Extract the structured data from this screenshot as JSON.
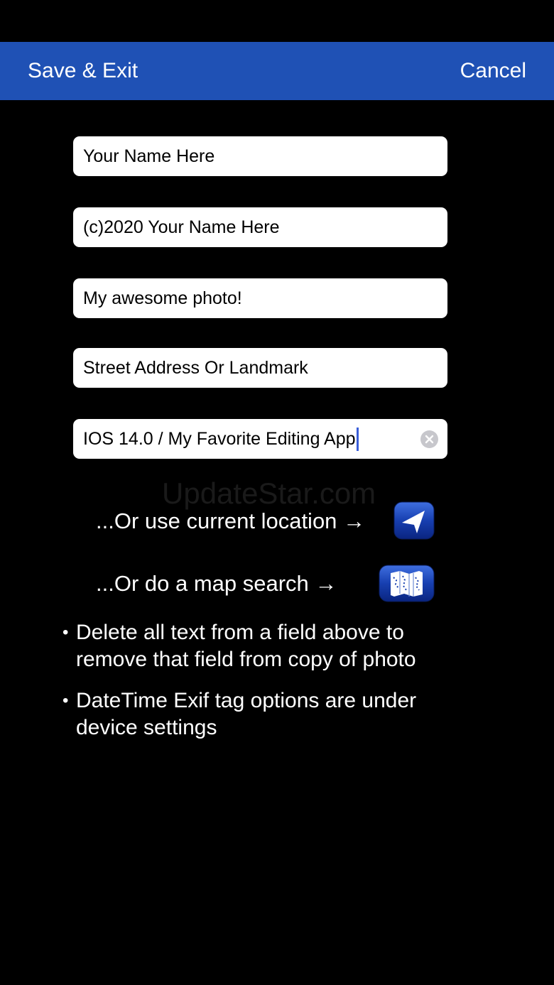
{
  "navbar": {
    "save_label": "Save & Exit",
    "cancel_label": "Cancel",
    "background": "#1f51b5"
  },
  "fields": {
    "artist": "Your Name Here",
    "copyright": "(c)2020 Your Name Here",
    "description": "My awesome photo!",
    "location": "Street Address Or Landmark",
    "software": "IOS 14.0 / My Favorite Editing App"
  },
  "watermark": "UpdateStar.com",
  "options": {
    "current_location": "...Or use current location →",
    "map_search": "...Or do a map search →",
    "location_icon": "location-arrow-icon",
    "map_icon": "map-icon"
  },
  "notes": {
    "bullet": "•",
    "note1_line1": "Delete all text from a field above to",
    "note1_line2": "remove that field from copy of photo",
    "note2_line1": "DateTime Exif tag options are under",
    "note2_line2": "device settings"
  }
}
